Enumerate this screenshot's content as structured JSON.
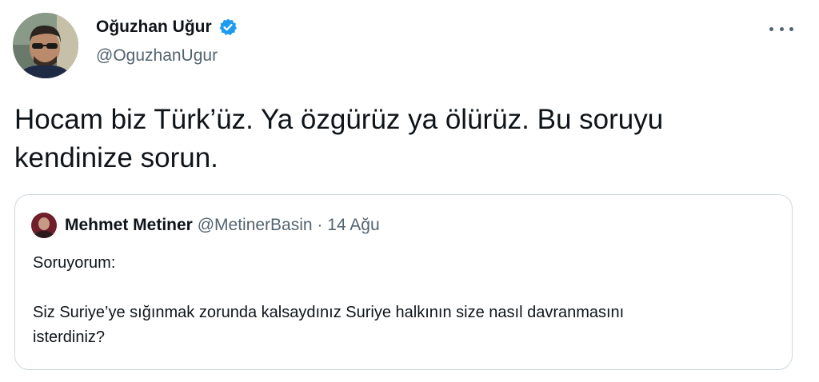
{
  "author": {
    "display_name": "Oğuzhan Uğur",
    "handle": "@OguzhanUgur",
    "verified_icon": "verified-badge-icon",
    "badge_color": "#1d9bf0"
  },
  "tweet": {
    "text_line1": "Hocam biz Türk’üz. Ya özgürüz ya ölürüz. Bu soruyu",
    "text_line2": "kendinize sorun."
  },
  "quoted": {
    "display_name": "Mehmet Metiner",
    "handle": "@MetinerBasin",
    "separator": "·",
    "date": "14 Ağu",
    "line1": "Soruyorum:",
    "line2": "Siz Suriye’ye sığınmak zorunda kalsaydınız Suriye halkının size nasıl davranmasını",
    "line3": "isterdiniz?"
  },
  "menu_icon": "more-options-icon"
}
